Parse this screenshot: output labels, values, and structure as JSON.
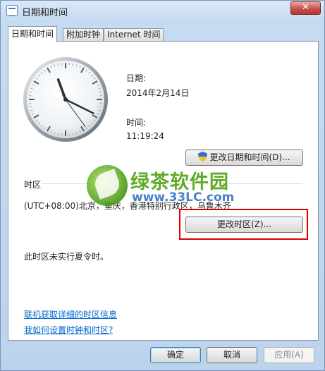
{
  "window": {
    "title": "日期和时间",
    "close_label": "✕"
  },
  "tabs": [
    {
      "label": "日期和时间",
      "active": true
    },
    {
      "label": "附加时钟",
      "active": false
    },
    {
      "label": "Internet 时间",
      "active": false
    }
  ],
  "datetime": {
    "date_label": "日期:",
    "date_value": "2014年2月14日",
    "time_label": "时间:",
    "time_value": "11:19:24",
    "change_datetime_button": "更改日期和时间(D)..."
  },
  "clock": {
    "hours": 11,
    "minutes": 19,
    "seconds": 24
  },
  "timezone": {
    "section_label": "时区",
    "value": "(UTC+08:00)北京，重庆，香港特别行政区，乌鲁木齐",
    "change_timezone_button": "更改时区(Z)...",
    "dst_note": "此时区未实行夏令时。"
  },
  "links": {
    "online_info": "联机获取详细的时区信息",
    "how_to": "我如何设置时钟和时区?"
  },
  "footer": {
    "ok": "确定",
    "cancel": "取消",
    "apply": "应用(A)"
  },
  "watermark": {
    "name": "绿茶软件园",
    "url": "www.33LC.com"
  },
  "colors": {
    "highlight_box": "#e00000",
    "link": "#0066cc"
  }
}
